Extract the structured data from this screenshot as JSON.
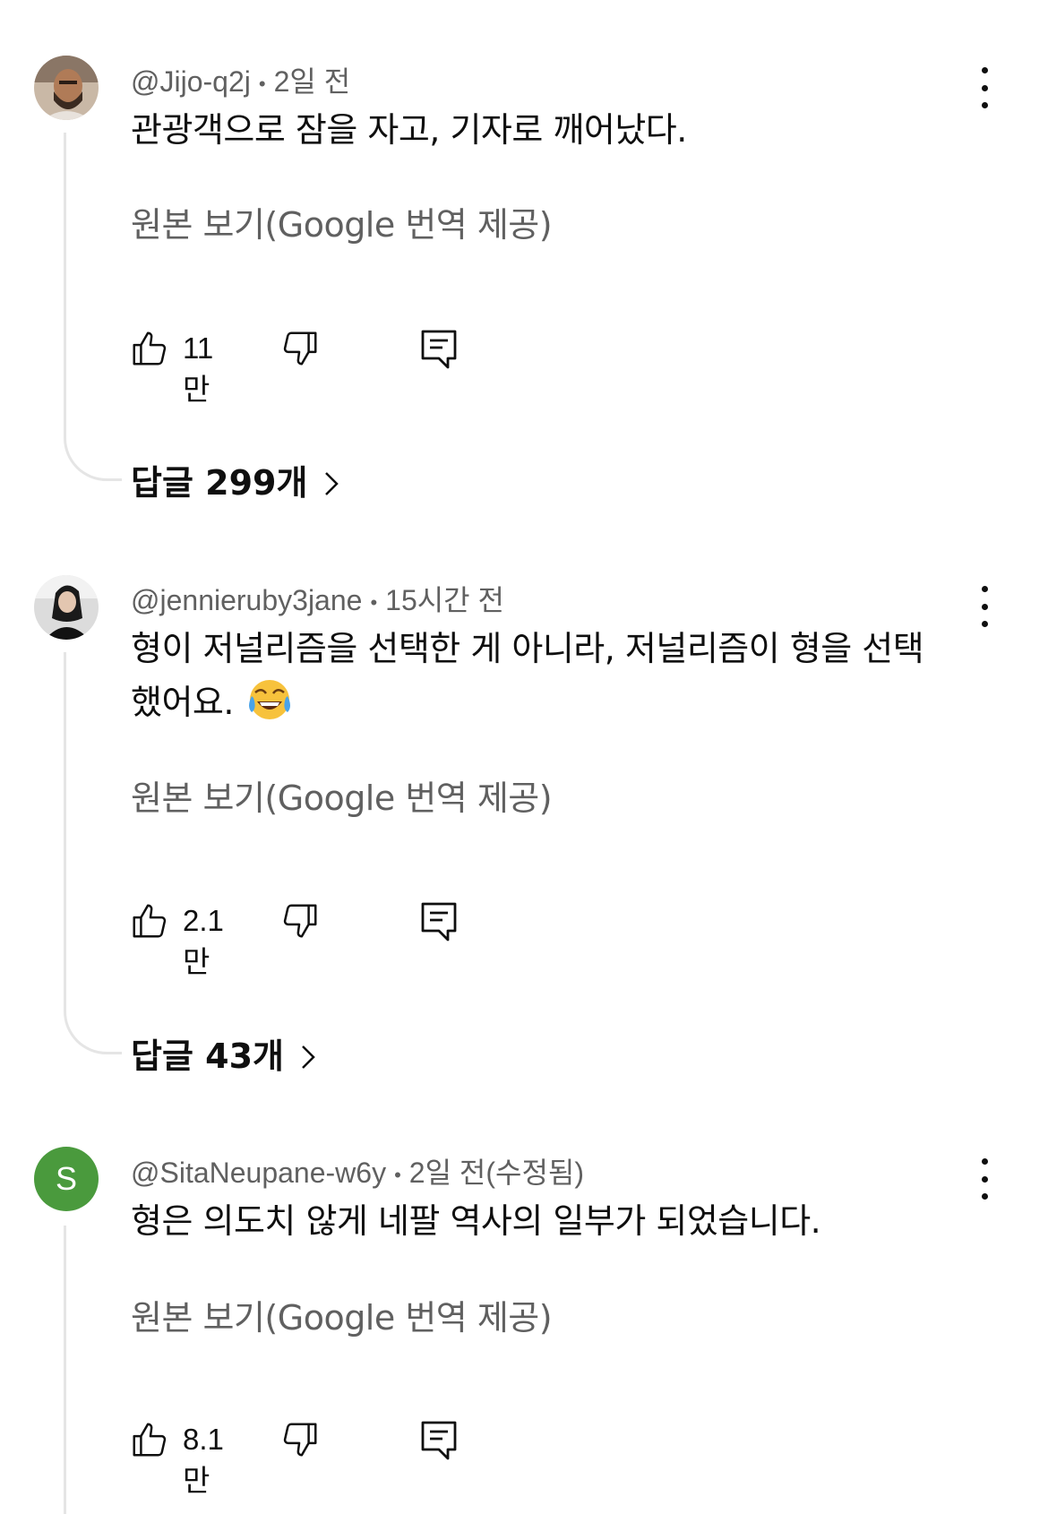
{
  "comments": [
    {
      "author": "@Jijo-q2j",
      "time": "2일 전",
      "text": "관광객으로 잠을 자고, 기자로 깨어났다.",
      "translate_link": "원본 보기(Google 번역 제공)",
      "likes": "11만",
      "replies_label": "답글 299개",
      "avatar": "photo"
    },
    {
      "author": "@jennieruby3jane",
      "time": "15시간 전",
      "text_line1": "형이 저널리즘을 선택한 게 아니라, 저널리즘이 형을 선택",
      "text_line2": "했어요.",
      "emoji": "😂",
      "translate_link": "원본 보기(Google 번역 제공)",
      "likes": "2.1만",
      "replies_label": "답글 43개",
      "avatar": "photo"
    },
    {
      "author": "@SitaNeupane-w6y",
      "time": "2일 전(수정됨)",
      "text": "형은 의도치 않게 네팔 역사의 일부가 되었습니다.",
      "translate_link": "원본 보기(Google 번역 제공)",
      "likes": "8.1만",
      "avatar_letter": "S",
      "avatar_color": "#4a9a3d"
    }
  ],
  "icons": {
    "like": "thumbs-up-icon",
    "dislike": "thumbs-down-icon",
    "reply": "comment-reply-icon",
    "more": "more-vertical-icon",
    "chevron": "chevron-right-icon"
  }
}
